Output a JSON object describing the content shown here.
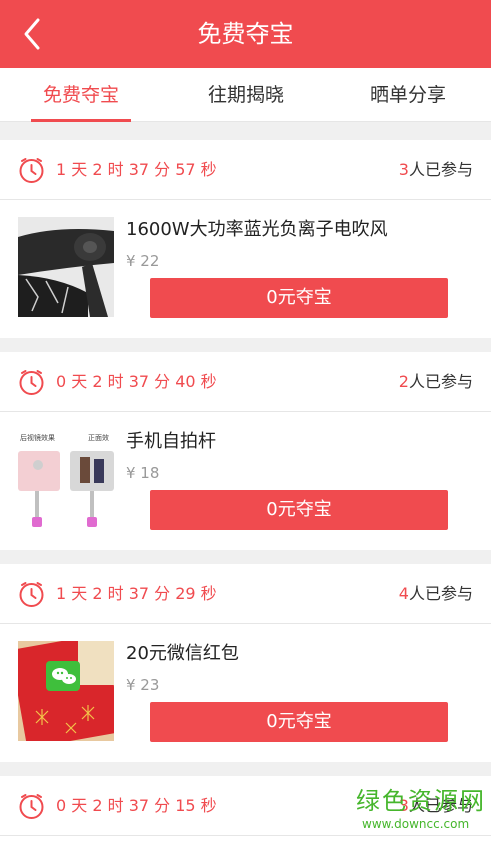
{
  "header": {
    "title": "免费夺宝"
  },
  "tabs": [
    {
      "label": "免费夺宝",
      "active": true
    },
    {
      "label": "往期揭晓",
      "active": false
    },
    {
      "label": "晒单分享",
      "active": false
    }
  ],
  "colors": {
    "accent": "#f04b4f",
    "watermark": "#46b62c"
  },
  "items": [
    {
      "countdown": "1 天 2 时 37 分 57 秒",
      "participants_count": "3",
      "participants_suffix": "人已参与",
      "title": "1600W大功率蓝光负离子电吹风",
      "price": "¥ 22",
      "button": "0元夺宝",
      "image": "hair-dryer-image"
    },
    {
      "countdown": "0 天 2 时 37 分 40 秒",
      "participants_count": "2",
      "participants_suffix": "人已参与",
      "title": "手机自拍杆",
      "price": "¥ 18",
      "button": "0元夺宝",
      "image": "selfie-stick-image",
      "image_captions": [
        "后视镜效果",
        "正面效"
      ]
    },
    {
      "countdown": "1 天 2 时 37 分 29 秒",
      "participants_count": "4",
      "participants_suffix": "人已参与",
      "title": "20元微信红包",
      "price": "¥ 23",
      "button": "0元夺宝",
      "image": "wechat-red-envelope-image"
    },
    {
      "countdown": "0 天 2 时 37 分 15 秒",
      "participants_count": "3",
      "participants_suffix": "人已参与"
    }
  ],
  "watermark": {
    "text": "绿色资源网",
    "url": "www.downcc.com"
  }
}
